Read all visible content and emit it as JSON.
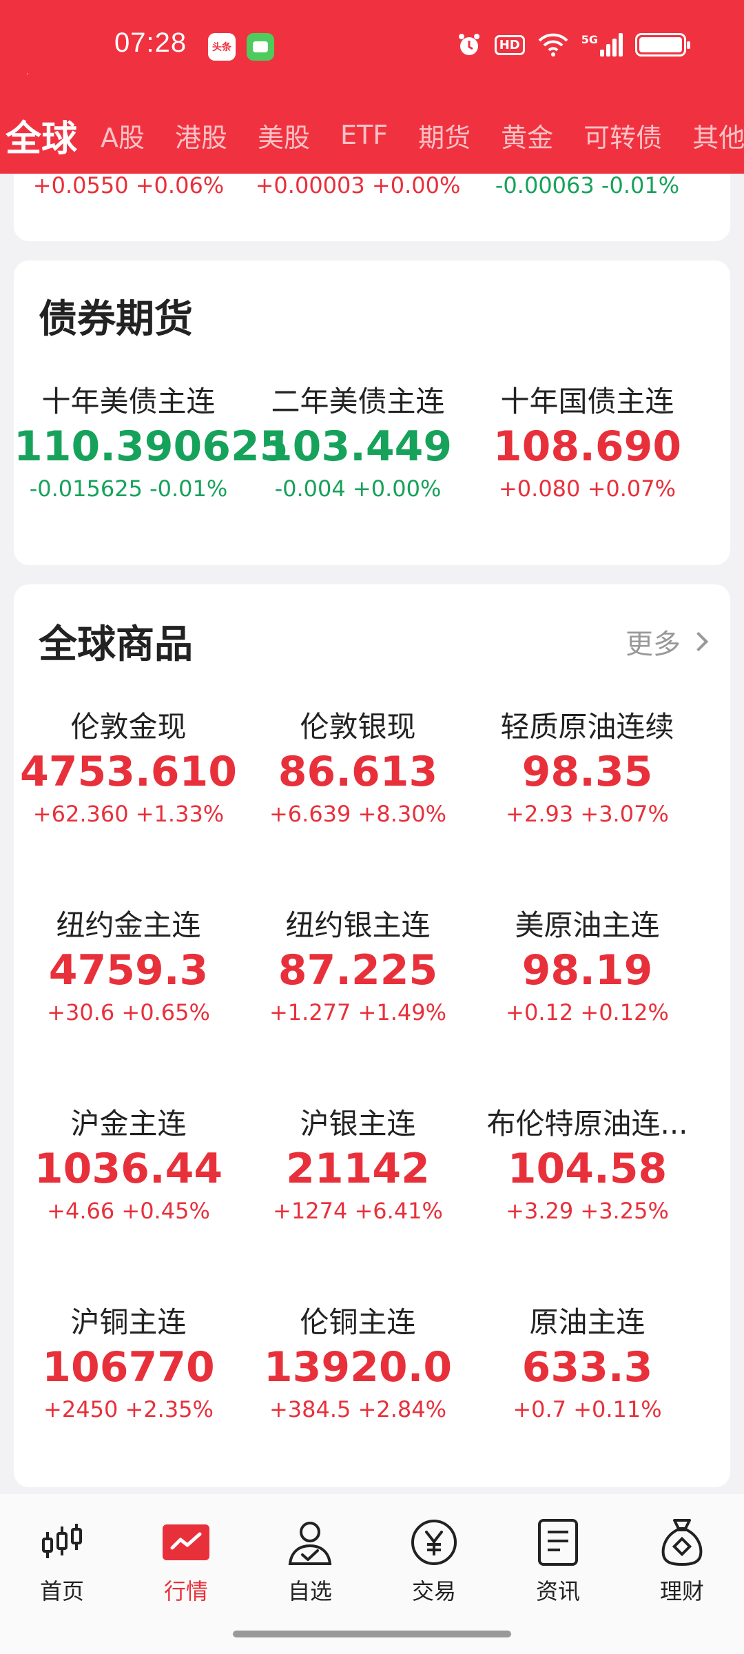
{
  "status_bar": {
    "time": "07:28",
    "toutiao_badge": "头条",
    "network": "5G",
    "hd": "HD"
  },
  "tabs": [
    "全球",
    "A股",
    "港股",
    "美股",
    "ETF",
    "期货",
    "黄金",
    "可转债",
    "其他"
  ],
  "partial_row": [
    {
      "change": "+0.0550 +0.06%",
      "dir": "up"
    },
    {
      "change": "+0.00003 +0.00%",
      "dir": "up"
    },
    {
      "change": "-0.00063 -0.01%",
      "dir": "down"
    }
  ],
  "bonds": {
    "title": "债券期货",
    "items": [
      {
        "name": "十年美债主连",
        "price": "110.390625",
        "change": "-0.015625 -0.01%",
        "dir": "down"
      },
      {
        "name": "二年美债主连",
        "price": "103.449",
        "change": "-0.004 +0.00%",
        "dir": "down"
      },
      {
        "name": "十年国债主连",
        "price": "108.690",
        "change": "+0.080 +0.07%",
        "dir": "up"
      }
    ]
  },
  "commodities": {
    "title": "全球商品",
    "more_label": "更多",
    "items": [
      {
        "name": "伦敦金现",
        "price": "4753.610",
        "change": "+62.360 +1.33%",
        "dir": "up"
      },
      {
        "name": "伦敦银现",
        "price": "86.613",
        "change": "+6.639 +8.30%",
        "dir": "up"
      },
      {
        "name": "轻质原油连续",
        "price": "98.35",
        "change": "+2.93 +3.07%",
        "dir": "up"
      },
      {
        "name": "纽约金主连",
        "price": "4759.3",
        "change": "+30.6 +0.65%",
        "dir": "up"
      },
      {
        "name": "纽约银主连",
        "price": "87.225",
        "change": "+1.277 +1.49%",
        "dir": "up"
      },
      {
        "name": "美原油主连",
        "price": "98.19",
        "change": "+0.12 +0.12%",
        "dir": "up"
      },
      {
        "name": "沪金主连",
        "price": "1036.44",
        "change": "+4.66 +0.45%",
        "dir": "up"
      },
      {
        "name": "沪银主连",
        "price": "21142",
        "change": "+1274 +6.41%",
        "dir": "up"
      },
      {
        "name": "布伦特原油连...",
        "price": "104.58",
        "change": "+3.29 +3.25%",
        "dir": "up"
      },
      {
        "name": "沪铜主连",
        "price": "106770",
        "change": "+2450 +2.35%",
        "dir": "up"
      },
      {
        "name": "伦铜主连",
        "price": "13920.0",
        "change": "+384.5 +2.84%",
        "dir": "up"
      },
      {
        "name": "原油主连",
        "price": "633.3",
        "change": "+0.7 +0.11%",
        "dir": "up"
      }
    ]
  },
  "colors": {
    "up": "#e8303b",
    "down": "#17a25b",
    "brand": "#f03240"
  },
  "bottom_nav": [
    {
      "label": "首页",
      "icon": "candlestick-icon"
    },
    {
      "label": "行情",
      "icon": "chart-trend-icon",
      "active": true
    },
    {
      "label": "自选",
      "icon": "user-check-icon"
    },
    {
      "label": "交易",
      "icon": "yen-icon"
    },
    {
      "label": "资讯",
      "icon": "document-icon"
    },
    {
      "label": "理财",
      "icon": "money-bag-icon"
    }
  ]
}
